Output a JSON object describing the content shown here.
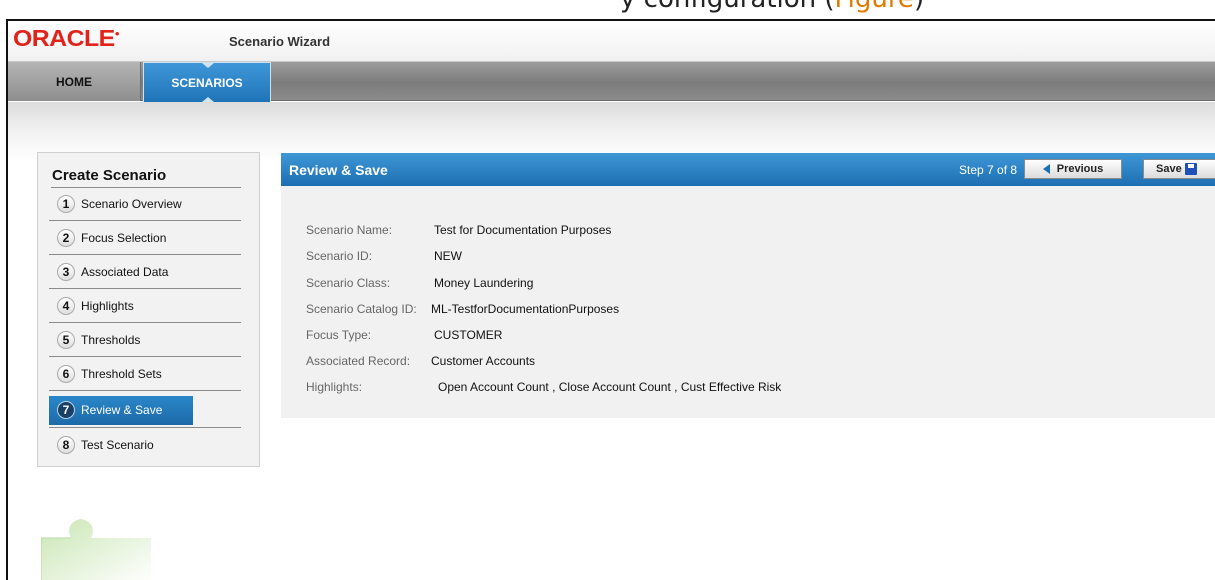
{
  "document": {
    "caption_fragment": "y configuration",
    "caption_fig": "Figure",
    "caption_tail": ")"
  },
  "app": {
    "logo_text": "ORACLE",
    "title": "Scenario Wizard"
  },
  "nav": {
    "tabs": [
      {
        "label": "HOME"
      },
      {
        "label": "SCENARIOS"
      }
    ]
  },
  "sidebar": {
    "title": "Create Scenario",
    "steps": [
      {
        "num": "1",
        "label": "Scenario Overview"
      },
      {
        "num": "2",
        "label": "Focus Selection"
      },
      {
        "num": "3",
        "label": "Associated Data"
      },
      {
        "num": "4",
        "label": "Highlights"
      },
      {
        "num": "5",
        "label": "Thresholds"
      },
      {
        "num": "6",
        "label": "Threshold Sets"
      },
      {
        "num": "7",
        "label": "Review & Save"
      },
      {
        "num": "8",
        "label": "Test Scenario"
      }
    ],
    "active_step": 7
  },
  "main": {
    "title": "Review & Save",
    "step_indicator": "Step 7 of 8",
    "previous_label": "Previous",
    "save_label": "Save",
    "fields": [
      {
        "label": "Scenario Name:",
        "value": "Test for Documentation Purposes"
      },
      {
        "label": "Scenario ID:",
        "value": "NEW"
      },
      {
        "label": "Scenario Class:",
        "value": "Money Laundering"
      },
      {
        "label": "Scenario Catalog ID:",
        "value": "ML-TestforDocumentationPurposes"
      },
      {
        "label": "Focus Type:",
        "value": "CUSTOMER"
      },
      {
        "label": "Associated Record:",
        "value": "Customer Accounts"
      },
      {
        "label": "Highlights:",
        "value": "Open Account Count , Close Account Count , Cust Effective Risk"
      }
    ]
  },
  "colors": {
    "brand_red": "#e2231a",
    "accent_blue": "#1f74b7"
  }
}
